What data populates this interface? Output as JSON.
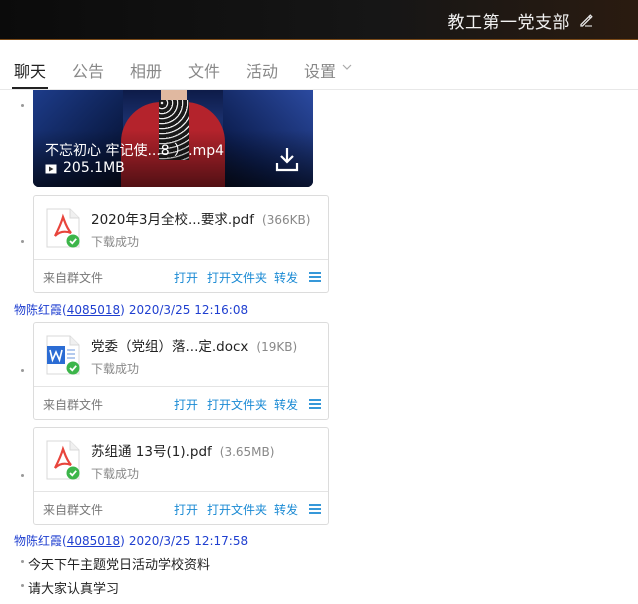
{
  "window": {
    "title": "教工第一党支部"
  },
  "tabs": [
    {
      "label": "聊天",
      "active": true
    },
    {
      "label": "公告"
    },
    {
      "label": "相册"
    },
    {
      "label": "文件"
    },
    {
      "label": "活动"
    },
    {
      "label": "设置"
    }
  ],
  "video": {
    "name": "不忘初心 牢记使...8 ）.mp4",
    "size": "205.1MB"
  },
  "files": [
    {
      "name": "2020年3月全校...要求.pdf",
      "size": "(366KB)",
      "status": "下载成功",
      "source": "来自群文件",
      "type": "pdf"
    },
    {
      "name": "党委（党组）落...定.docx",
      "size": "(19KB)",
      "status": "下载成功",
      "source": "来自群文件",
      "type": "word"
    },
    {
      "name": "苏组通 13号(1).pdf",
      "size": "(3.65MB)",
      "status": "下载成功",
      "source": "来自群文件",
      "type": "pdf"
    }
  ],
  "actions": {
    "open": "打开",
    "open_folder": "打开文件夹",
    "forward": "转发"
  },
  "senders": [
    {
      "name": "物陈红霞",
      "uid_open": "(",
      "uid": "4085018",
      "uid_close": ")",
      "time": "2020/3/25 12:16:08"
    },
    {
      "name": "物陈红霞",
      "uid_open": "(",
      "uid": "4085018",
      "uid_close": ")",
      "time": "2020/3/25 12:17:58"
    }
  ],
  "messages": [
    "今天下午主题党日活动学校资料",
    "请大家认真学习"
  ],
  "colors": {
    "link": "#1a8ad4",
    "sender": "#1f3fd0",
    "pdf": "#e8453c",
    "word": "#2b6cd4",
    "success": "#3cb54a"
  }
}
